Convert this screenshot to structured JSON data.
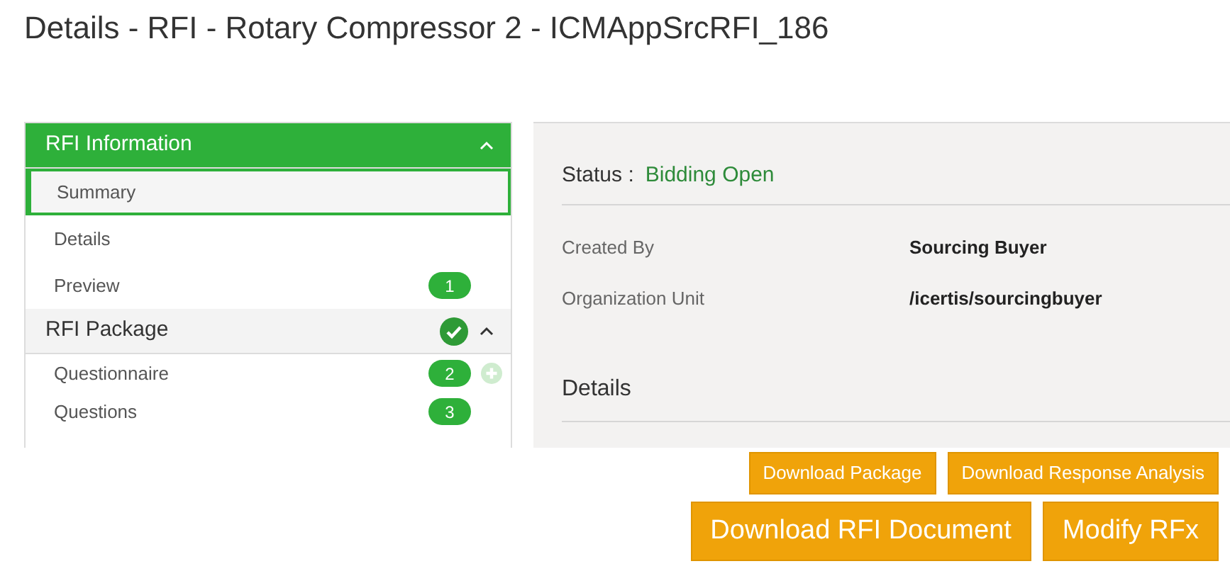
{
  "page_title": "Details - RFI - Rotary Compressor 2 - ICMAppSrcRFI_186",
  "sidebar": {
    "sections": [
      {
        "title": "RFI Information",
        "active": true,
        "expanded": true,
        "complete": false,
        "items": [
          {
            "label": "Summary",
            "selected": true
          },
          {
            "label": "Details",
            "selected": false
          },
          {
            "label": "Preview",
            "selected": false,
            "badge": "1"
          }
        ]
      },
      {
        "title": "RFI Package",
        "active": false,
        "expanded": true,
        "complete": true,
        "items": [
          {
            "label": "Questionnaire",
            "selected": false,
            "badge": "2",
            "addable": true
          },
          {
            "label": "Questions",
            "selected": false,
            "badge": "3"
          }
        ]
      }
    ]
  },
  "main": {
    "status_label": "Status :",
    "status_value": "Bidding Open",
    "fields": [
      {
        "label": "Created By",
        "value": "Sourcing Buyer"
      },
      {
        "label": "Organization Unit",
        "value": "/icertis/sourcingbuyer"
      }
    ],
    "section_heading": "Details"
  },
  "small_buttons": [
    {
      "label": "Download Package"
    },
    {
      "label": "Download Response Analysis"
    }
  ],
  "large_buttons": [
    {
      "label": "Download RFI Document"
    },
    {
      "label": "Modify RFx"
    }
  ]
}
